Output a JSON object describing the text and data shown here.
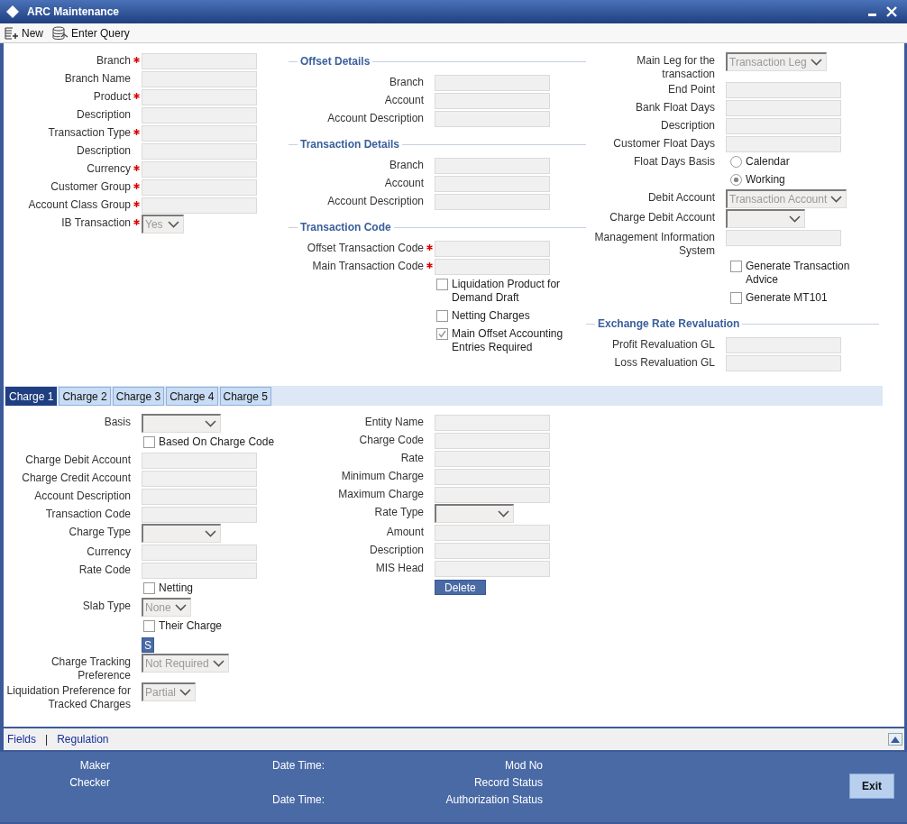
{
  "window": {
    "title": "ARC Maintenance"
  },
  "toolbar": [
    {
      "label": "New",
      "kind": "new"
    },
    {
      "label": "Enter Query",
      "kind": "query"
    }
  ],
  "form": {
    "columns": [
      {
        "sections": [
          {
            "rows": [
              {
                "kind": "text",
                "label": "Branch",
                "required": true
              },
              {
                "kind": "text",
                "label": "Branch Name",
                "required": false
              },
              {
                "kind": "text",
                "label": "Product",
                "required": true
              },
              {
                "kind": "text",
                "label": "Description",
                "required": false
              },
              {
                "kind": "text",
                "label": "Transaction Type",
                "required": true
              },
              {
                "kind": "text",
                "label": "Description",
                "required": false
              },
              {
                "kind": "text",
                "label": "Currency",
                "required": true
              },
              {
                "kind": "text",
                "label": "Customer Group",
                "required": true
              },
              {
                "kind": "text",
                "label": "Account Class Group",
                "required": true
              },
              {
                "kind": "select",
                "label": "IB Transaction",
                "required": true,
                "value": "Yes"
              }
            ]
          }
        ]
      },
      {
        "sections": [
          {
            "heading": "Offset Details",
            "rows": [
              {
                "kind": "text",
                "label": "Branch",
                "required": false
              },
              {
                "kind": "text",
                "label": "Account",
                "required": false
              },
              {
                "kind": "text",
                "label": "Account Description",
                "required": false
              }
            ]
          },
          {
            "heading": "Transaction Details",
            "rows": [
              {
                "kind": "text",
                "label": "Branch",
                "required": false
              },
              {
                "kind": "text",
                "label": "Account",
                "required": false
              },
              {
                "kind": "text",
                "label": "Account Description",
                "required": false
              }
            ]
          },
          {
            "heading": "Transaction Code",
            "rows": [
              {
                "kind": "text",
                "label": "Offset Transaction Code",
                "required": true
              },
              {
                "kind": "text",
                "label": "Main Transaction Code",
                "required": true
              },
              {
                "kind": "checkbox",
                "option": "Liquidation Product for Demand Draft",
                "checked": false
              },
              {
                "kind": "checkbox",
                "option": "Netting Charges",
                "checked": false
              },
              {
                "kind": "checkbox",
                "option": "Main Offset Accounting Entries Required",
                "checked": true
              }
            ]
          }
        ]
      },
      {
        "sections": [
          {
            "rows": [
              {
                "kind": "select",
                "label": "Main Leg for the transaction",
                "required": false,
                "value": "Transaction Leg"
              },
              {
                "kind": "text",
                "label": "End Point",
                "required": false
              },
              {
                "kind": "text",
                "label": "Bank Float Days",
                "required": false
              },
              {
                "kind": "text",
                "label": "Description",
                "required": false
              },
              {
                "kind": "text",
                "label": "Customer Float Days",
                "required": false
              },
              {
                "kind": "radio",
                "label": "Float Days Basis",
                "option": "Calendar",
                "selected": false
              },
              {
                "kind": "radio",
                "option": "Working",
                "selected": true
              },
              {
                "kind": "select",
                "label": "Debit Account",
                "required": false,
                "value": "Transaction Account"
              },
              {
                "kind": "select",
                "label": "Charge Debit Account",
                "required": false
              },
              {
                "kind": "text",
                "label": "Management Information System",
                "required": false
              },
              {
                "kind": "checkbox",
                "option": "Generate Transaction Advice",
                "checked": false
              },
              {
                "kind": "checkbox",
                "option": "Generate MT101",
                "checked": false
              }
            ]
          },
          {
            "heading": "Exchange Rate Revaluation",
            "rows": [
              {
                "kind": "text",
                "label": "Profit Revaluation GL",
                "required": false
              },
              {
                "kind": "text",
                "label": "Loss Revaluation GL",
                "required": false
              }
            ]
          }
        ]
      }
    ]
  },
  "charge_tabs": [
    {
      "label": "Charge 1",
      "selected": true
    },
    {
      "label": "Charge 2",
      "selected": false
    },
    {
      "label": "Charge 3",
      "selected": false
    },
    {
      "label": "Charge 4",
      "selected": false
    },
    {
      "label": "Charge 5",
      "selected": false
    }
  ],
  "charge_form": {
    "columns": [
      {
        "sections": [
          {
            "rows": [
              {
                "kind": "select",
                "label": "Basis",
                "required": false
              },
              {
                "kind": "checkbox",
                "option": "Based On Charge Code",
                "checked": false
              },
              {
                "kind": "text",
                "label": "Charge Debit Account",
                "required": false
              },
              {
                "kind": "text",
                "label": "Charge Credit Account",
                "required": false
              },
              {
                "kind": "text",
                "label": "Account Description",
                "required": false
              },
              {
                "kind": "text",
                "label": "Transaction Code",
                "required": false
              },
              {
                "kind": "select",
                "label": "Charge Type",
                "required": false
              },
              {
                "kind": "text",
                "label": "Currency",
                "required": false
              },
              {
                "kind": "text",
                "label": "Rate Code",
                "required": false
              },
              {
                "kind": "checkbox",
                "option": "Netting",
                "checked": false
              },
              {
                "kind": "select",
                "label": "Slab Type",
                "required": false,
                "value": "None"
              },
              {
                "kind": "checkbox",
                "option": "Their Charge",
                "checked": false
              },
              {
                "kind": "button",
                "text": "S"
              },
              {
                "kind": "select",
                "label": "Charge Tracking Preference",
                "required": false,
                "value": "Not Required"
              },
              {
                "kind": "select",
                "label": "Liquidation Preference for Tracked Charges",
                "required": false,
                "value": "Partial"
              }
            ]
          }
        ]
      },
      {
        "sections": [
          {
            "rows": [
              {
                "kind": "text",
                "label": "Entity Name",
                "required": false
              },
              {
                "kind": "text",
                "label": "Charge Code",
                "required": false
              },
              {
                "kind": "text",
                "label": "Rate",
                "required": false
              },
              {
                "kind": "text",
                "label": "Minimum Charge",
                "required": false
              },
              {
                "kind": "text",
                "label": "Maximum Charge",
                "required": false
              },
              {
                "kind": "select",
                "label": "Rate Type",
                "required": false
              },
              {
                "kind": "text",
                "label": "Amount",
                "required": false
              },
              {
                "kind": "text",
                "label": "Description",
                "required": false
              },
              {
                "kind": "text",
                "label": "MIS Head",
                "required": false
              },
              {
                "kind": "button",
                "text": "Delete"
              }
            ]
          }
        ]
      }
    ]
  },
  "links": [
    "Fields",
    "Regulation"
  ],
  "link_separator": "|",
  "audit": [
    {
      "maker_label": "Maker",
      "date_label": "Date Time:",
      "status_label": "Mod No"
    },
    {
      "maker_label": "Checker",
      "status_label": "Record Status"
    },
    {
      "date_label": "Date Time:",
      "status_label": "Authorization Status"
    }
  ],
  "exit_button": "Exit"
}
